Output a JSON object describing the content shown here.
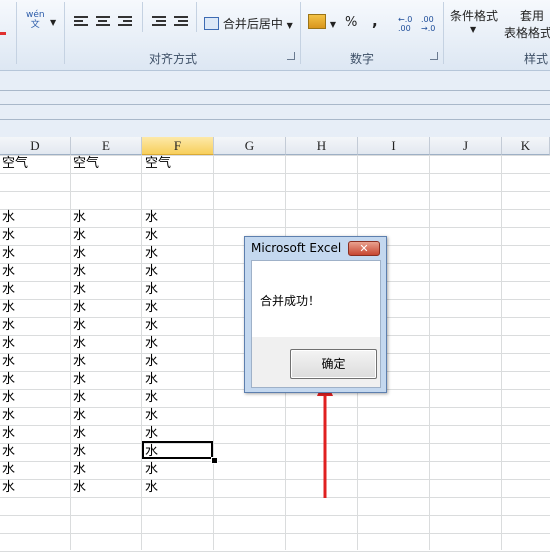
{
  "ribbon": {
    "wen_icon_label": "wén\n文",
    "merge_center_label": "合并后居中",
    "percent_label": "%",
    "comma_label": ",",
    "inc_decimal_label": "←.0\n.00",
    "dec_decimal_label": ".00\n→.0",
    "conditional_format_label": "条件格式",
    "table_format_line1": "套用",
    "table_format_line2": "表格格式",
    "group_alignment": "对齐方式",
    "group_number": "数字",
    "group_style": "样式"
  },
  "columns": [
    "D",
    "E",
    "F",
    "G",
    "H",
    "I",
    "J",
    "K"
  ],
  "sheet": {
    "header_row": [
      "空气",
      "空气",
      "空气"
    ],
    "water": "水",
    "water_rows": 16
  },
  "dialog": {
    "title": "Microsoft Excel",
    "close_label": "✕",
    "message": "合并成功！",
    "ok_label": "确定"
  },
  "annotation": {
    "arrow_color": "#e02020"
  }
}
